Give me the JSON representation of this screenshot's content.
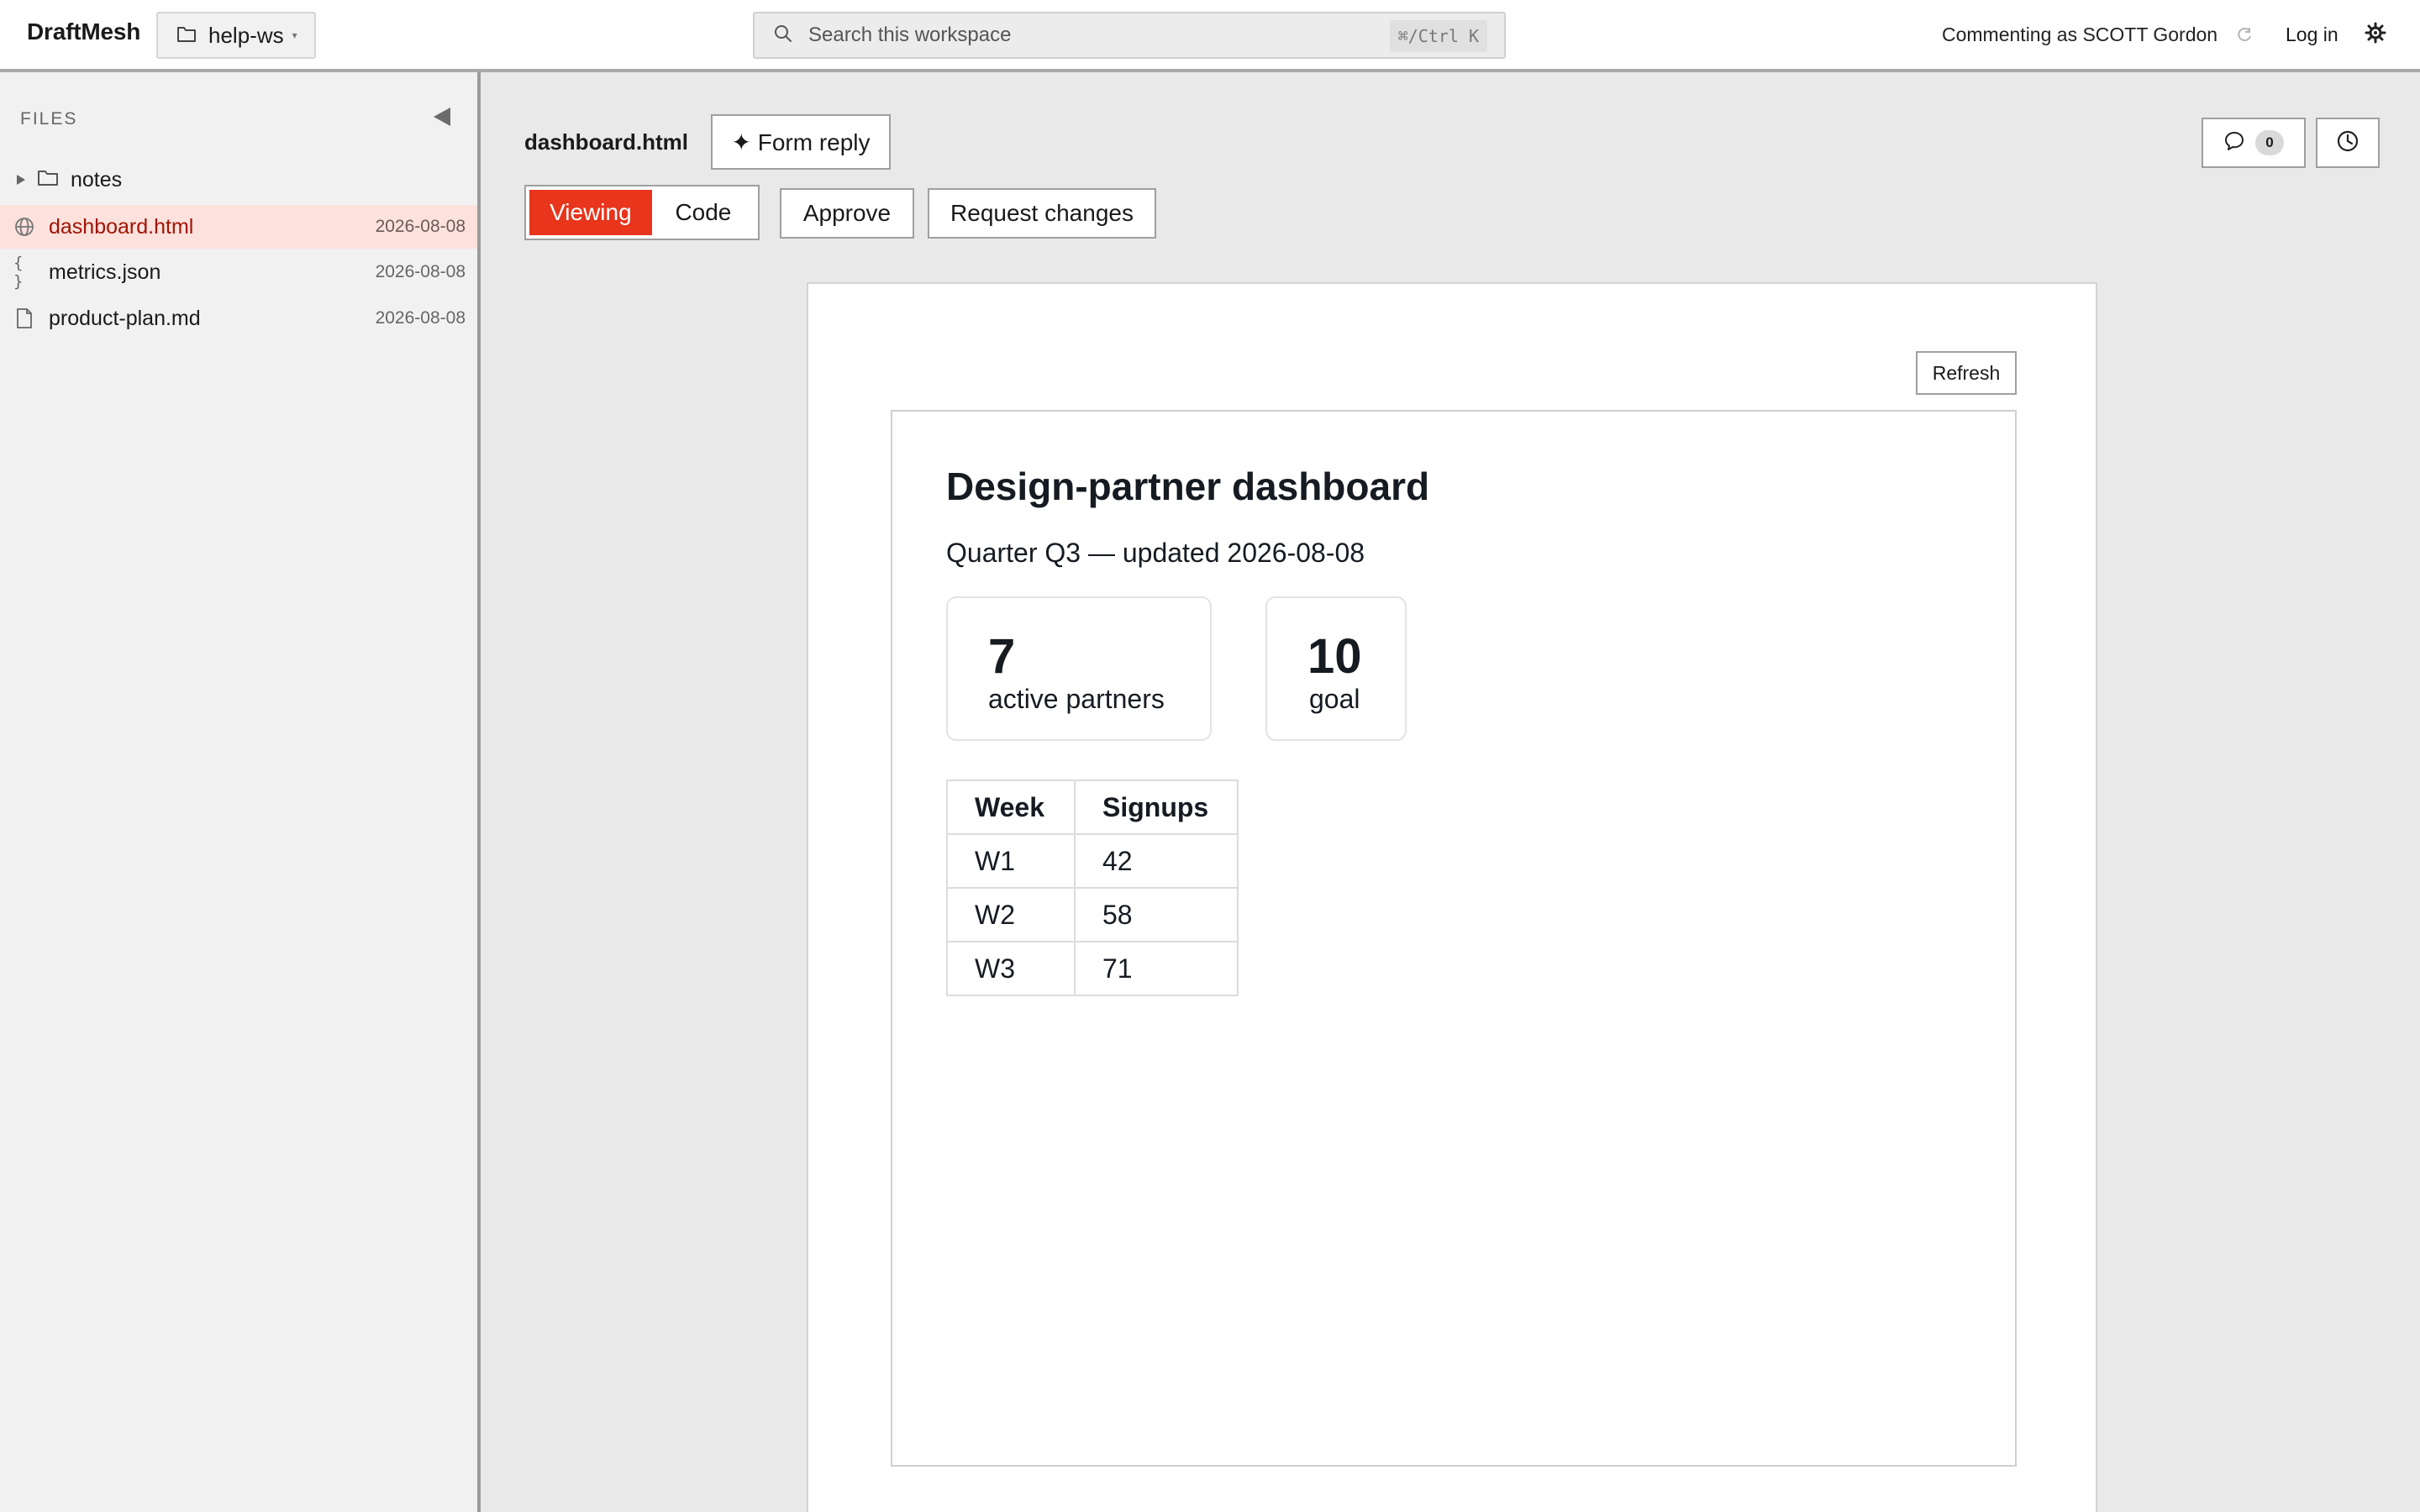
{
  "app": {
    "brand": "DraftMesh",
    "workspace": "help-ws",
    "search_placeholder": "Search this workspace",
    "search_shortcut": "⌘/Ctrl K",
    "commenting_as": "Commenting as SCOTT Gordon",
    "login_label": "Log in"
  },
  "sidebar": {
    "heading": "FILES",
    "folder": {
      "name": "notes",
      "icon": "folder-icon"
    },
    "files": [
      {
        "name": "dashboard.html",
        "date": "2026-08-08",
        "icon": "globe-icon",
        "active": true
      },
      {
        "name": "metrics.json",
        "date": "2026-08-08",
        "icon": "json-icon",
        "active": false
      },
      {
        "name": "product-plan.md",
        "date": "2026-08-08",
        "icon": "file-icon",
        "active": false
      }
    ]
  },
  "toolbar": {
    "filename": "dashboard.html",
    "form_reply_label": "✦ Form reply",
    "viewing_label": "Viewing",
    "code_label": "Code",
    "approve_label": "Approve",
    "request_changes_label": "Request changes",
    "comment_count": "0"
  },
  "preview": {
    "refresh_label": "Refresh",
    "title": "Design-partner dashboard",
    "subtitle": "Quarter Q3 — updated 2026-08-08",
    "stats": [
      {
        "value": "7",
        "label": "active partners"
      },
      {
        "value": "10",
        "label": "goal"
      }
    ],
    "table": {
      "headers": [
        "Week",
        "Signups"
      ],
      "rows": [
        [
          "W1",
          "42"
        ],
        [
          "W2",
          "58"
        ],
        [
          "W3",
          "71"
        ]
      ]
    }
  },
  "colors": {
    "accent": "#e8351c",
    "active_row_bg": "#fde1dc",
    "active_row_text": "#a11405"
  }
}
